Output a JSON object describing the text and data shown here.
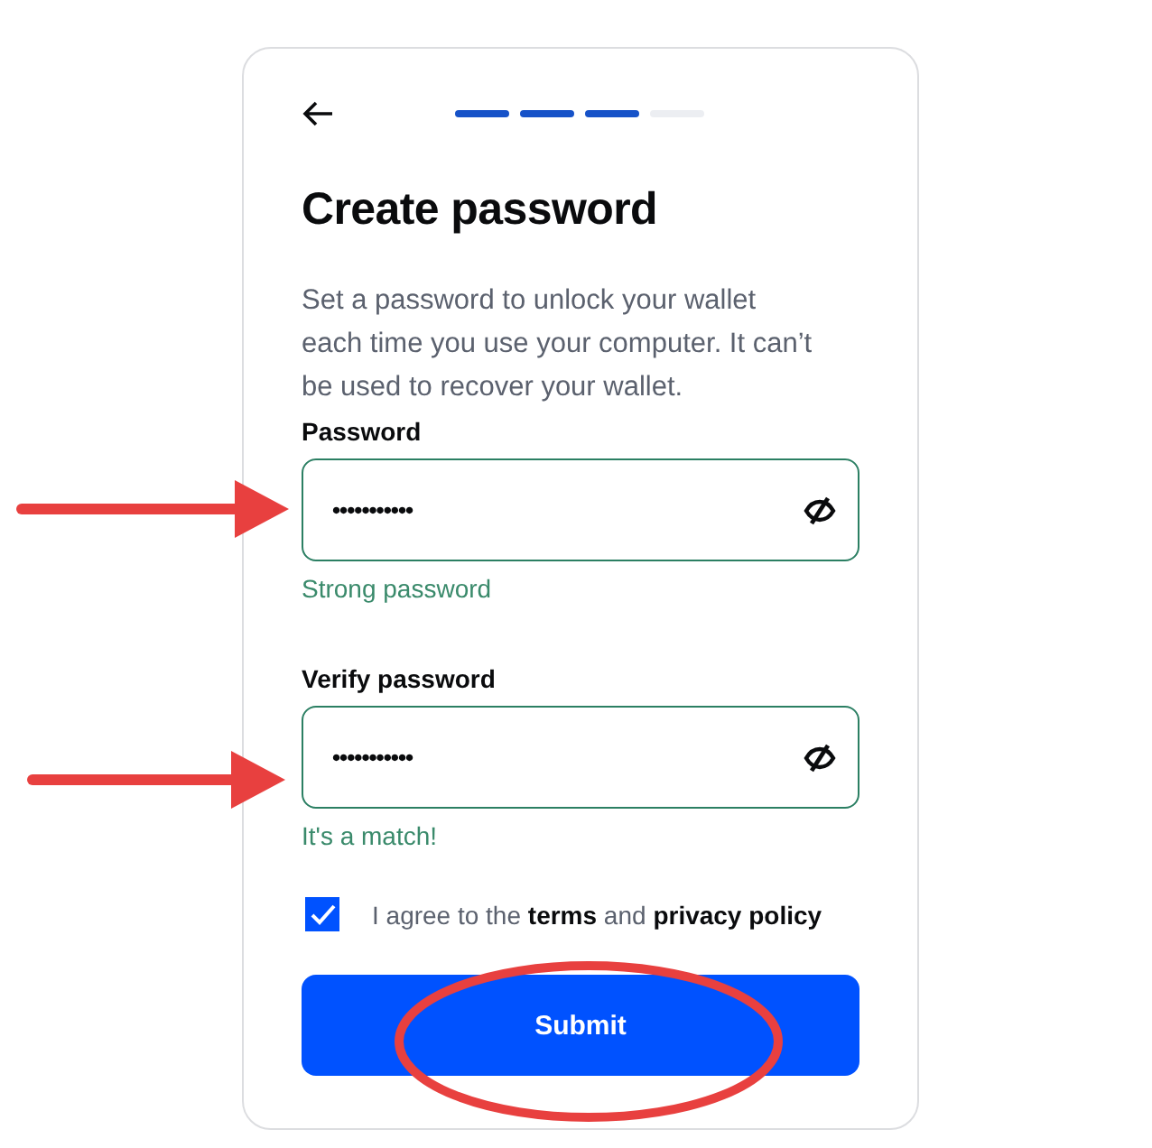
{
  "progress": {
    "steps": [
      {
        "completed": true
      },
      {
        "completed": true
      },
      {
        "completed": true
      },
      {
        "completed": false
      }
    ]
  },
  "title": "Create password",
  "description": "Set a password to unlock your wallet each time you use your computer. It can’t be used to recover your wallet.",
  "fields": [
    {
      "label": "Password",
      "value": "•••••••••••",
      "hint": "Strong password",
      "valid": true
    },
    {
      "label": "Verify password",
      "value": "•••••••••••",
      "hint": "It's a match!",
      "valid": true
    }
  ],
  "agreement": {
    "checked": true,
    "text": "I agree to the **terms** and **privacy policy**"
  },
  "submit_button": "Submit",
  "annotations": [
    {
      "kind": "arrow"
    },
    {
      "kind": "arrow"
    },
    {
      "kind": "ellipse"
    }
  ]
}
